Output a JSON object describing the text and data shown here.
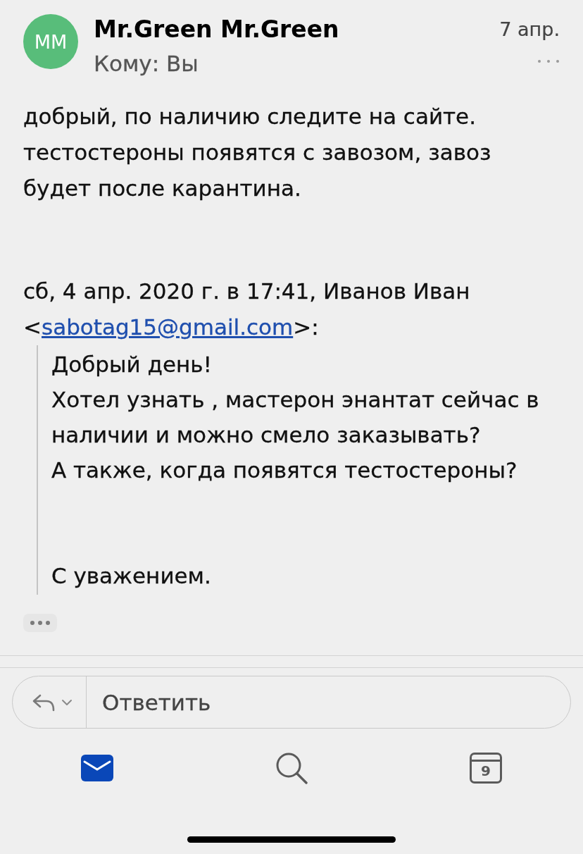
{
  "header": {
    "avatar_initials": "MM",
    "sender": "Mr.Green Mr.Green",
    "recipient": "Кому: Вы",
    "date": "7 апр."
  },
  "message": {
    "lines": [
      "добрый, по наличию следите на сайте.",
      "тестостероны появятся с завозом, завоз",
      "будет после карантина."
    ]
  },
  "attribution": {
    "text": "сб, 4 апр. 2020 г. в 17:41, Иванов Иван",
    "open": "<",
    "email": "sabotag15@gmail.com",
    "close": ">:"
  },
  "quote": {
    "paragraphs": [
      [
        "Добрый день!",
        "Хотел узнать , мастерон энантат сейчас в",
        "наличии и можно смело заказывать?",
        "А также, когда появятся тестостероны?"
      ],
      [
        "С уважением."
      ]
    ]
  },
  "reply_bar": {
    "label": "Ответить"
  },
  "tabs": [
    {
      "kind": "mail",
      "selected": true
    },
    {
      "kind": "search",
      "selected": false
    },
    {
      "kind": "calendar",
      "selected": false,
      "label": "9"
    }
  ]
}
